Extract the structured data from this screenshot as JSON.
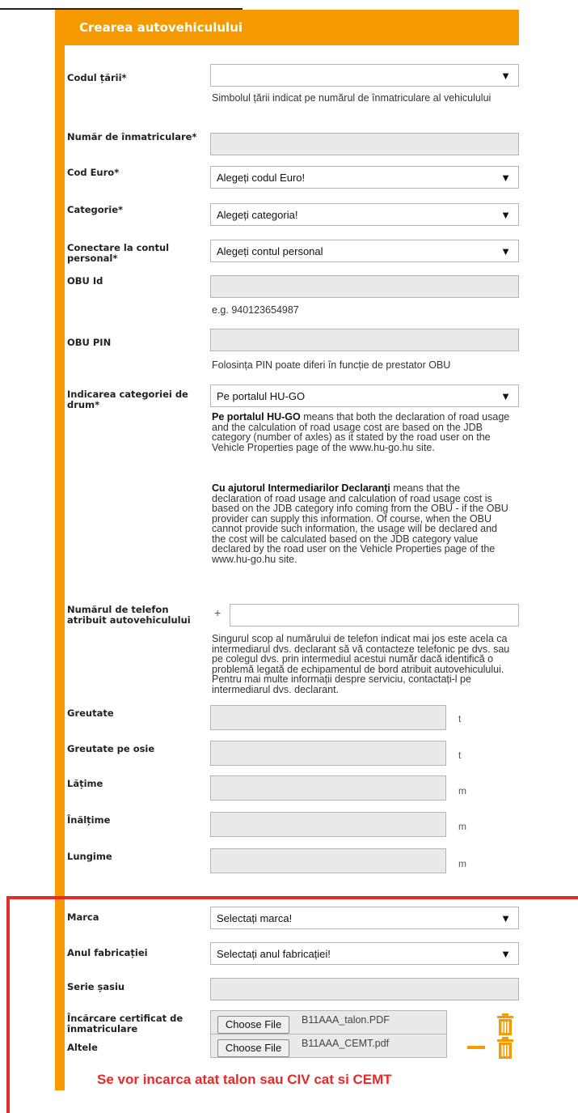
{
  "header": {
    "title": "Crearea autovehiculului"
  },
  "fields": {
    "country_code": {
      "label": "Codul țării*",
      "value": "",
      "help": "Simbolul țării indicat pe numărul de înmatriculare al vehiculului"
    },
    "plate_number": {
      "label": "Număr de înmatriculare*",
      "value": ""
    },
    "euro_code": {
      "label": "Cod Euro*",
      "value": "Alegeți codul Euro!"
    },
    "category": {
      "label": "Categorie*",
      "value": "Alegeți categoria!"
    },
    "personal_account": {
      "label": "Conectare la contul personal*",
      "value": "Alegeți contul personal"
    },
    "obu_id": {
      "label": "OBU Id",
      "value": "",
      "help": "e.g. 940123654987"
    },
    "obu_pin": {
      "label": "OBU PIN",
      "value": "",
      "help": "Folosința PIN poate diferi în funcție de prestator OBU"
    },
    "road_category": {
      "label": "Indicarea categoriei de drum*",
      "value": "Pe portalul HU-GO",
      "help1_bold": "Pe portalul HU-GO",
      "help1_text": " means that both the declaration of road usage and the calculation of road usage cost are based on the JDB category (number of axles) as it stated by the road user on the Vehicle Properties page of the www.hu-go.hu site.",
      "help2_bold": "Cu ajutorul Intermediarilor Declaranți",
      "help2_text": " means that the declaration of road usage and calculation of road usage cost is based on the JDB category info coming from the OBU - if the OBU provider can supply this information. Of course, when the OBU cannot provide such information, the usage will be declared and the cost will be calculated based on the JDB category value declared by the road user on the Vehicle Properties page of the www.hu-go.hu site."
    },
    "phone": {
      "label": "Numărul de telefon atribuit autovehiculului",
      "prefix": "+",
      "value": "",
      "help": "Singurul scop al numărului de telefon indicat mai jos este acela ca intermediarul dvs. declarant să vă contacteze telefonic pe dvs. sau pe colegul dvs. prin intermediul acestui număr dacă identifică o problemă legată de echipamentul de bord atribuit autovehiculului. Pentru mai multe informații despre serviciu, contactați-l pe intermediarul dvs. declarant."
    },
    "weight": {
      "label": "Greutate",
      "value": "",
      "unit": "t"
    },
    "axle_weight": {
      "label": "Greutate pe osie",
      "value": "",
      "unit": "t"
    },
    "width": {
      "label": "Lățime",
      "value": "",
      "unit": "m"
    },
    "height": {
      "label": "Înălțime",
      "value": "",
      "unit": "m"
    },
    "length": {
      "label": "Lungime",
      "value": "",
      "unit": "m"
    },
    "brand": {
      "label": "Marca",
      "value": "Selectați marca!"
    },
    "year": {
      "label": "Anul fabricației",
      "value": "Selectați anul fabricației!"
    },
    "chassis": {
      "label": "Serie șasiu",
      "value": ""
    },
    "registration_cert": {
      "label": "Încărcare certificat de înmatriculare",
      "button": "Choose File",
      "file": "B11AAA_talon.PDF"
    },
    "other": {
      "label": "Altele",
      "button": "Choose File",
      "file": "B11AAA_CEMT.pdf"
    }
  },
  "icons": {
    "dropdown": "triangle-down-icon",
    "delete": "trash-icon",
    "remove": "minus-icon"
  },
  "colors": {
    "accent": "#f59a00",
    "annotation": "#e52a2a"
  },
  "annotation": "Se vor incarca atat talon sau CIV cat si CEMT"
}
